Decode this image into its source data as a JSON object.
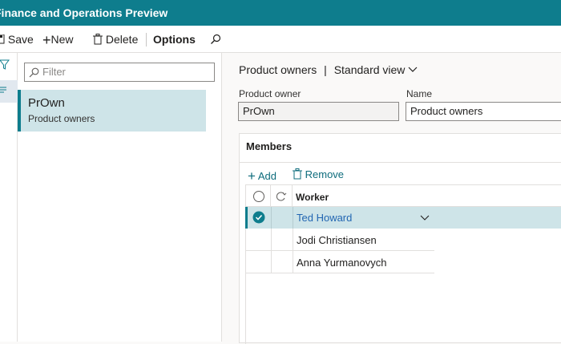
{
  "app": {
    "title": "Finance and Operations Preview"
  },
  "actions": {
    "save": "Save",
    "new": "New",
    "delete": "Delete",
    "options": "Options"
  },
  "list": {
    "filter_placeholder": "Filter",
    "items": [
      {
        "code": "PrOwn",
        "name": "Product owners"
      }
    ]
  },
  "header": {
    "form_title": "Product owners",
    "separator": "|",
    "view": "Standard view"
  },
  "fields": {
    "product_owner": {
      "label": "Product owner",
      "value": "PrOwn"
    },
    "name": {
      "label": "Name",
      "value": "Product owners"
    }
  },
  "members": {
    "title": "Members",
    "add": "Add",
    "remove": "Remove",
    "column_worker": "Worker",
    "rows": [
      {
        "worker": "Ted Howard",
        "selected": true
      },
      {
        "worker": "Jodi Christiansen",
        "selected": false
      },
      {
        "worker": "Anna Yurmanovych",
        "selected": false
      }
    ]
  },
  "colors": {
    "accent": "#0e7d8d",
    "selected_row": "#cee4e8",
    "link": "#2266b2"
  }
}
